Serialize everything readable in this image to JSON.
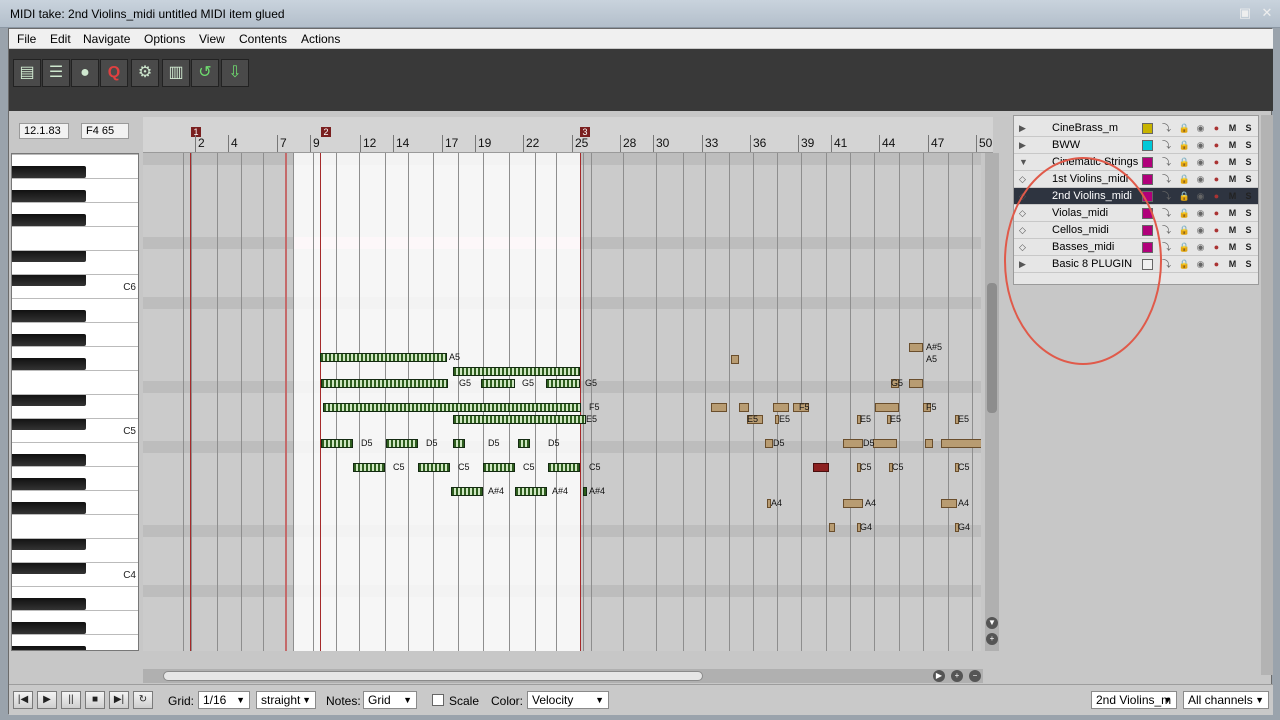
{
  "window": {
    "title": "MIDI take: 2nd Violins_midi untitled MIDI item glued",
    "restore_icon": "restore-icon",
    "close_icon": "close-icon"
  },
  "menu": [
    "File",
    "Edit",
    "Navigate",
    "Options",
    "View",
    "Contents",
    "Actions"
  ],
  "toolbar": {
    "icons": [
      "list-icon",
      "lines-icon",
      "palette-icon",
      "quantize-icon",
      "humanize-icon",
      "grid-icon",
      "loop-icon",
      "import-icon"
    ],
    "glyphs": [
      "▤",
      "☰",
      "●",
      "Q",
      "⚙",
      "▥",
      "↺",
      "⇩"
    ]
  },
  "position": {
    "time": "12.1.83",
    "note": "F4 65"
  },
  "ruler": {
    "labels": [
      "2",
      "4",
      "7",
      "9",
      "12",
      "14",
      "17",
      "19",
      "22",
      "25",
      "28",
      "30",
      "33",
      "36",
      "39",
      "41",
      "44",
      "47",
      "50"
    ],
    "markers": [
      "1",
      "2",
      "3"
    ]
  },
  "piano": {
    "octave_labels": [
      "C6",
      "C5",
      "C4"
    ]
  },
  "notes": {
    "labels": [
      "A5",
      "G5",
      "G5",
      "G5",
      "F5",
      "E5",
      "D5",
      "D5",
      "D5",
      "D5",
      "C5",
      "C5",
      "C5",
      "C5",
      "A#4",
      "A#4",
      "A#4",
      "A#5",
      "A5",
      "G5",
      "F5",
      "E5",
      "E5",
      "E5",
      "E5",
      "D5",
      "D5",
      "C5",
      "C5",
      "C5",
      "A4",
      "A4",
      "A4",
      "G4",
      "G4",
      "E5",
      "F5"
    ]
  },
  "tracks": [
    {
      "name": "CineBrass_m",
      "color": "#c8b400",
      "arrow": "▶"
    },
    {
      "name": "BWW",
      "color": "#00c8d8",
      "arrow": "▶"
    },
    {
      "name": "Cinematic Strings",
      "color": "#b0007a",
      "arrow": "▼"
    },
    {
      "name": "1st Violins_midi",
      "color": "#b0007a",
      "arrow": "◇"
    },
    {
      "name": "2nd Violins_midi",
      "color": "#b0007a",
      "arrow": "◇"
    },
    {
      "name": "Violas_midi",
      "color": "#b0007a",
      "arrow": "◇"
    },
    {
      "name": "Cellos_midi",
      "color": "#b0007a",
      "arrow": "◇"
    },
    {
      "name": "Basses_midi",
      "color": "#b0007a",
      "arrow": "◇"
    },
    {
      "name": "Basic 8 PLUGIN",
      "color": "#f0f0f0",
      "arrow": "▶"
    }
  ],
  "track_controls": {
    "mute": "M",
    "solo": "S"
  },
  "transport": {
    "buttons": [
      "rewind-icon",
      "play-icon",
      "pause-icon",
      "stop-icon",
      "forward-icon",
      "repeat-icon"
    ],
    "glyphs": [
      "|◀",
      "▶",
      "||",
      "■",
      "▶|",
      "↻"
    ]
  },
  "bottom": {
    "grid_label": "Grid:",
    "grid_value": "1/16",
    "swing_value": "straight",
    "notes_label": "Notes:",
    "notes_value": "Grid",
    "scale_label": "Scale",
    "color_label": "Color:",
    "color_value": "Velocity",
    "track_value": "2nd Violins_m",
    "channel_value": "All channels"
  }
}
